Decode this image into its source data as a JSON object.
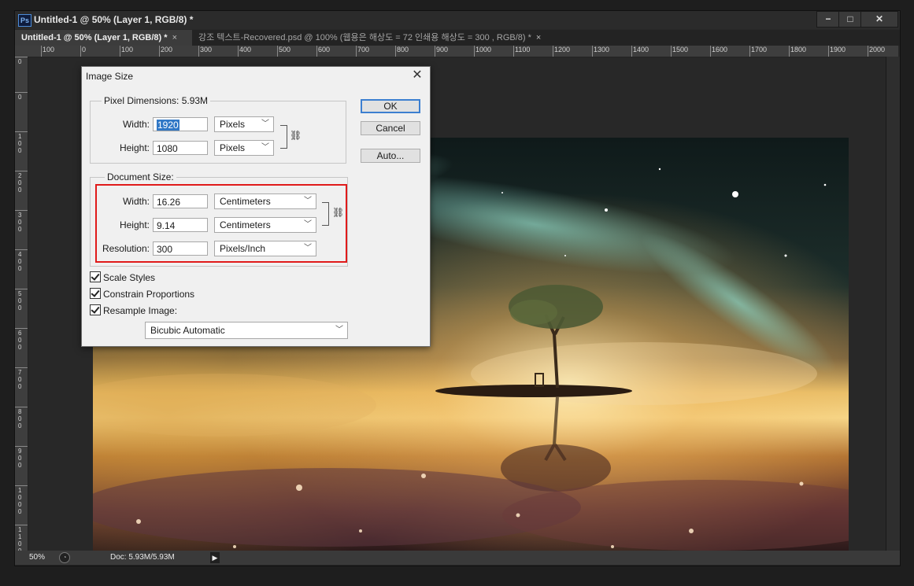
{
  "window": {
    "title": "Untitled-1 @ 50% (Layer 1, RGB/8) *",
    "app_icon": "Ps",
    "controls": {
      "minimize": "−",
      "maximize": "□",
      "close": "✕"
    }
  },
  "tabs": [
    {
      "label": "Untitled-1 @ 50% (Layer 1, RGB/8) *",
      "close": "×"
    },
    {
      "label": "강조 텍스트-Recovered.psd @ 100% (웹용은 해상도 = 72 인쇄용 해상도 = 300 , RGB/8) *",
      "close": "×"
    }
  ],
  "ruler_top": [
    "100",
    "0",
    "100",
    "200",
    "300",
    "400",
    "500",
    "600",
    "700",
    "800",
    "900",
    "1000",
    "1100",
    "1200",
    "1300",
    "1400",
    "1500",
    "1600",
    "1700",
    "1800",
    "1900",
    "2000"
  ],
  "ruler_left": [
    "0",
    "0",
    "100",
    "200",
    "300",
    "400",
    "500",
    "600",
    "700",
    "800",
    "900",
    "1000",
    "1100"
  ],
  "status": {
    "zoom": "50%",
    "doc": "Doc: 5.93M/5.93M",
    "arrow": "▶"
  },
  "dialog": {
    "title": "Image Size",
    "close": "✕",
    "pixel_dimensions": {
      "label": "Pixel Dimensions:  5.93M",
      "width_label": "Width:",
      "width_value": "1920",
      "width_unit": "Pixels",
      "height_label": "Height:",
      "height_value": "1080",
      "height_unit": "Pixels"
    },
    "document_size": {
      "label": "Document Size:",
      "width_label": "Width:",
      "width_value": "16.26",
      "width_unit": "Centimeters",
      "height_label": "Height:",
      "height_value": "9.14",
      "height_unit": "Centimeters",
      "resolution_label": "Resolution:",
      "resolution_value": "300",
      "resolution_unit": "Pixels/Inch"
    },
    "buttons": {
      "ok": "OK",
      "cancel": "Cancel",
      "auto": "Auto..."
    },
    "checkboxes": [
      {
        "label": "Scale Styles",
        "checked": true
      },
      {
        "label": "Constrain Proportions",
        "checked": true
      },
      {
        "label": "Resample Image:",
        "checked": true
      }
    ],
    "resample_method": "Bicubic Automatic"
  }
}
